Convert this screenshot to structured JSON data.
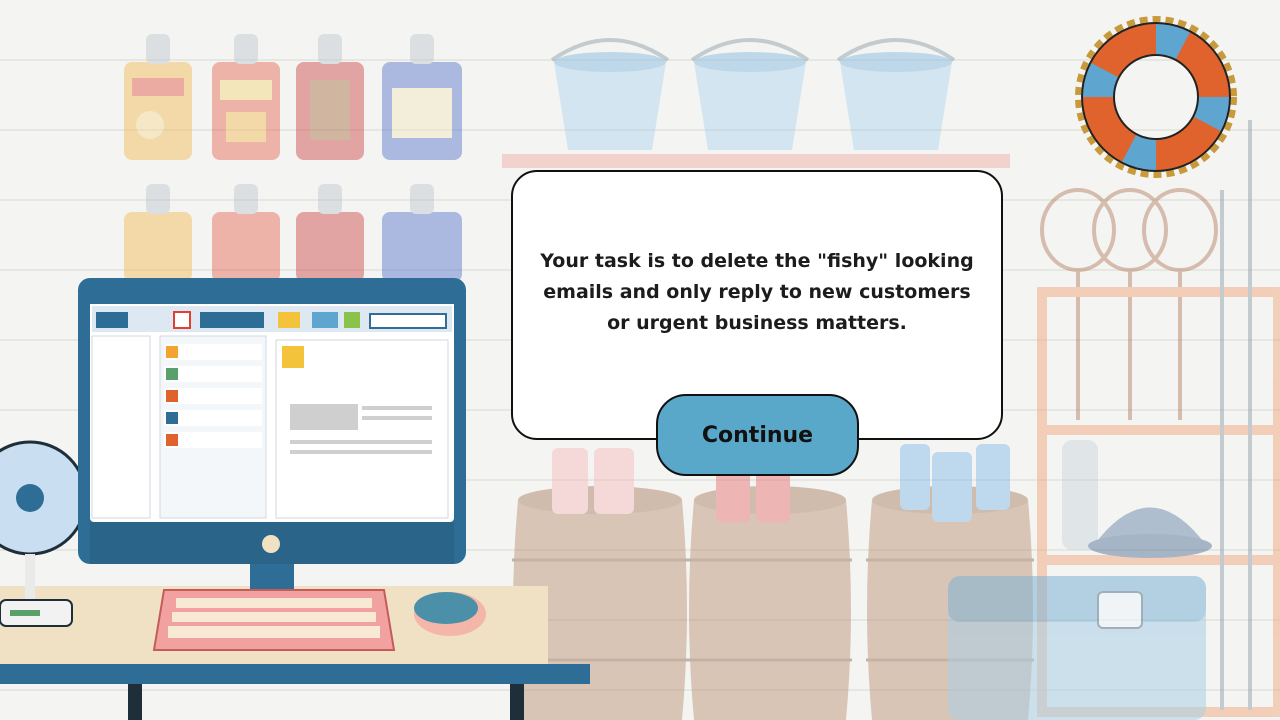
{
  "dialog": {
    "message": "Your task is to delete the \"fishy\" looking emails and only reply to new customers or urgent business matters."
  },
  "buttons": {
    "continue_label": "Continue"
  },
  "colors": {
    "button_fill": "#5aa8c9",
    "dialog_border": "#111111",
    "monitor_frame": "#2e6e96",
    "lifebuoy_orange": "#e0622c",
    "lifebuoy_blue": "#5ea6cf"
  },
  "icons": [
    "desk-fan-icon",
    "computer-monitor-icon",
    "keyboard-icon",
    "mouse-icon",
    "lifebuoy-icon",
    "barrel-icon",
    "bucket-icon",
    "chips-bag-icon",
    "soda-can-icon",
    "cooler-icon",
    "fishing-net-icon",
    "bucket-hat-icon"
  ]
}
